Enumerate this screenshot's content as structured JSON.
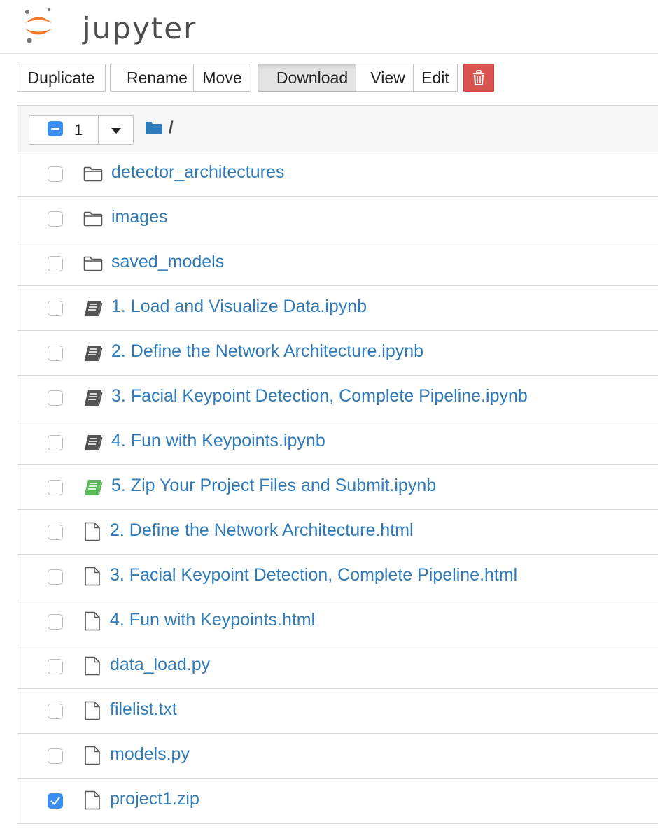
{
  "header": {
    "logo_text": "jupyter"
  },
  "toolbar": {
    "buttons": [
      {
        "label": "Duplicate"
      },
      {
        "label": "Rename"
      },
      {
        "label": "Move"
      },
      {
        "label": "Download",
        "active": true
      },
      {
        "label": "View"
      },
      {
        "label": "Edit"
      }
    ],
    "delete_icon": "trash-icon"
  },
  "list_header": {
    "selected_count": "1",
    "breadcrumb": "/"
  },
  "items": [
    {
      "name": "detector_architectures",
      "type": "folder",
      "checked": false
    },
    {
      "name": "images",
      "type": "folder",
      "checked": false
    },
    {
      "name": "saved_models",
      "type": "folder",
      "checked": false
    },
    {
      "name": "1. Load and Visualize Data.ipynb",
      "type": "notebook",
      "checked": false
    },
    {
      "name": "2. Define the Network Architecture.ipynb",
      "type": "notebook",
      "checked": false
    },
    {
      "name": "3. Facial Keypoint Detection, Complete Pipeline.ipynb",
      "type": "notebook",
      "checked": false
    },
    {
      "name": "4. Fun with Keypoints.ipynb",
      "type": "notebook",
      "checked": false
    },
    {
      "name": "5. Zip Your Project Files and Submit.ipynb",
      "type": "notebook-running",
      "checked": false
    },
    {
      "name": "2. Define the Network Architecture.html",
      "type": "file",
      "checked": false
    },
    {
      "name": "3. Facial Keypoint Detection, Complete Pipeline.html",
      "type": "file",
      "checked": false
    },
    {
      "name": "4. Fun with Keypoints.html",
      "type": "file",
      "checked": false
    },
    {
      "name": "data_load.py",
      "type": "file",
      "checked": false
    },
    {
      "name": "filelist.txt",
      "type": "file",
      "checked": false
    },
    {
      "name": "models.py",
      "type": "file",
      "checked": false
    },
    {
      "name": "project1.zip",
      "type": "file",
      "checked": true
    }
  ],
  "colors": {
    "link": "#2f7ab8",
    "notebook_icon": "#555555",
    "running_notebook_icon": "#5cb85c",
    "danger": "#d9534f",
    "checkbox_checked": "#3b8df0",
    "logo_orange": "#f37726",
    "logo_gray": "#767677"
  }
}
